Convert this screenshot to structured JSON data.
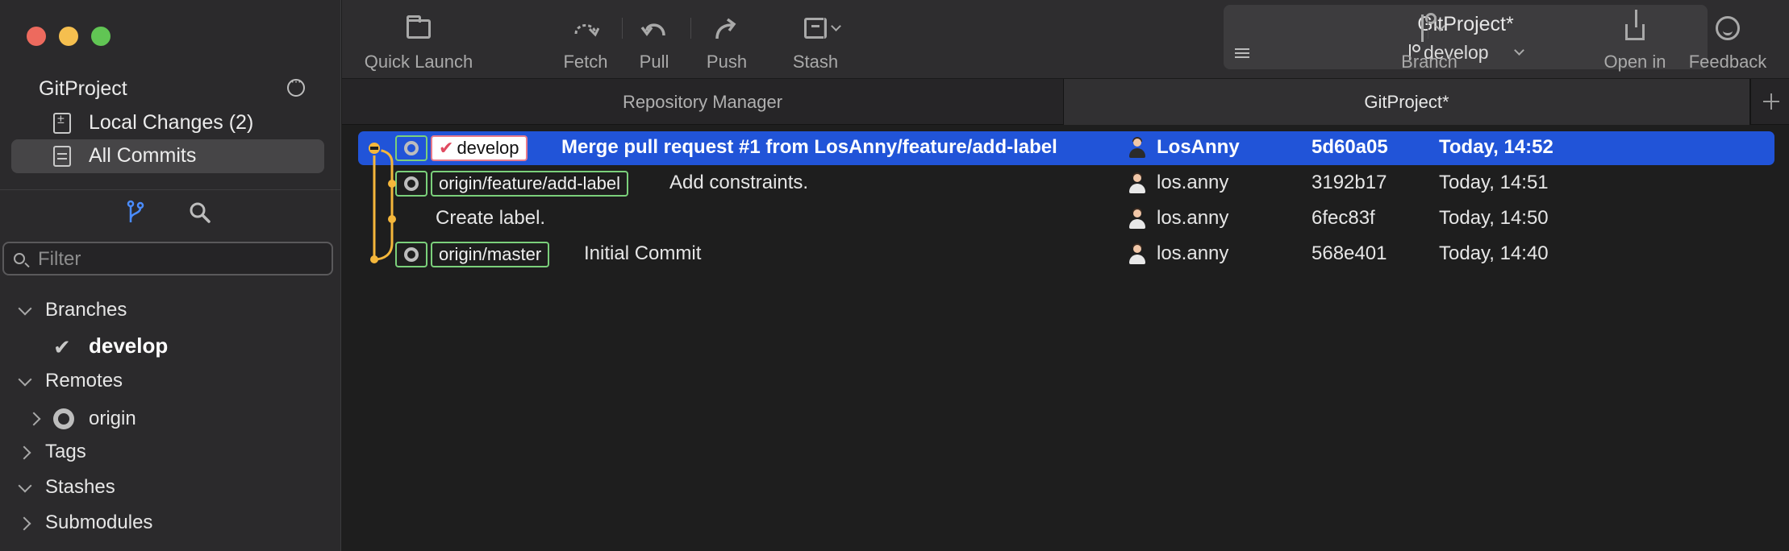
{
  "sidebar": {
    "repo_title": "GitProject",
    "nav": [
      {
        "label": "Local Changes (2)"
      },
      {
        "label": "All Commits"
      }
    ],
    "filter_placeholder": "Filter",
    "tree": {
      "branches_label": "Branches",
      "current_branch": "develop",
      "remotes_label": "Remotes",
      "remote_name": "origin",
      "tags_label": "Tags",
      "stashes_label": "Stashes",
      "submodules_label": "Submodules"
    }
  },
  "toolbar": {
    "quick_launch": "Quick Launch",
    "fetch": "Fetch",
    "pull": "Pull",
    "push": "Push",
    "stash": "Stash",
    "project_title": "GitProject*",
    "project_branch": "develop",
    "branch": "Branch",
    "open_in": "Open in",
    "feedback": "Feedback"
  },
  "tabs": [
    {
      "label": "Repository Manager",
      "active": false
    },
    {
      "label": "GitProject*",
      "active": true
    }
  ],
  "commits": [
    {
      "refs": [
        "develop"
      ],
      "message": "Merge pull request #1 from LosAnny/feature/add-label",
      "author": "LosAnny",
      "hash": "5d60a05",
      "date": "Today, 14:52",
      "selected": true
    },
    {
      "refs": [
        "origin/feature/add-label"
      ],
      "message": "Add constraints.",
      "author": "los.anny",
      "hash": "3192b17",
      "date": "Today, 14:51",
      "selected": false
    },
    {
      "refs": [],
      "message": "Create label.",
      "author": "los.anny",
      "hash": "6fec83f",
      "date": "Today, 14:50",
      "selected": false
    },
    {
      "refs": [
        "origin/master"
      ],
      "message": "Initial Commit",
      "author": "los.anny",
      "hash": "568e401",
      "date": "Today, 14:40",
      "selected": false
    }
  ],
  "colors": {
    "selection": "#2154d8",
    "graph_line": "#f5b73b",
    "remote_ref_border": "#7bd07b",
    "local_ref_border": "#e77a8a",
    "accent_icon": "#4a8cff"
  }
}
